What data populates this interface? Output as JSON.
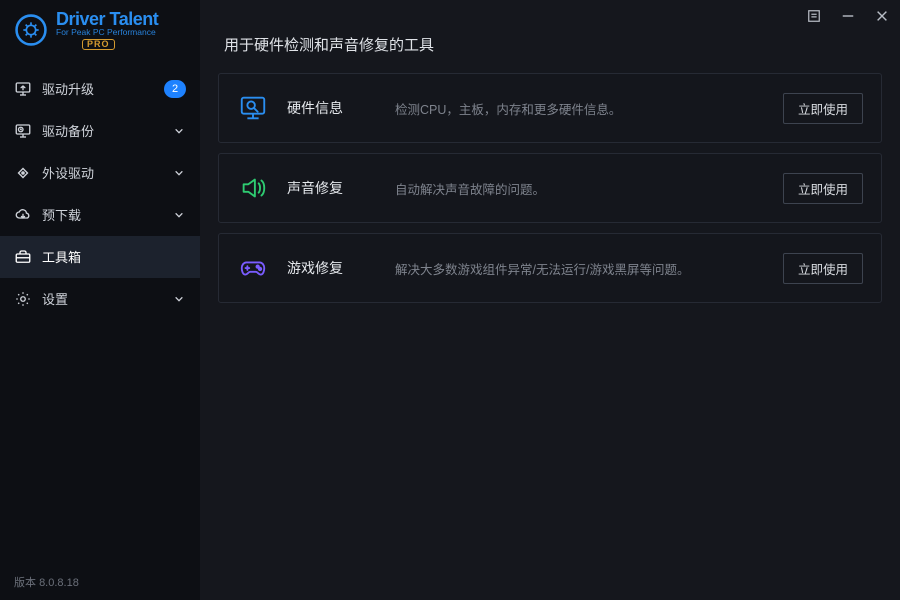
{
  "app": {
    "name": "Driver Talent",
    "tagline": "For Peak PC Performance",
    "edition": "PRO"
  },
  "window_controls": {
    "menu": "menu-icon",
    "minimize": "minimize-icon",
    "close": "close-icon"
  },
  "sidebar": {
    "items": [
      {
        "icon": "monitor-up-icon",
        "label": "驱动升级",
        "badge": "2",
        "has_caret": false
      },
      {
        "icon": "backup-icon",
        "label": "驱动备份",
        "badge": null,
        "has_caret": true
      },
      {
        "icon": "peripheral-icon",
        "label": "外设驱动",
        "badge": null,
        "has_caret": true
      },
      {
        "icon": "cloud-download-icon",
        "label": "预下载",
        "badge": null,
        "has_caret": true
      },
      {
        "icon": "toolbox-icon",
        "label": "工具箱",
        "badge": null,
        "has_caret": false,
        "active": true
      },
      {
        "icon": "gear-icon",
        "label": "设置",
        "badge": null,
        "has_caret": true
      }
    ],
    "version_prefix": "版本",
    "version": "8.0.8.18"
  },
  "page": {
    "title": "用于硬件检测和声音修复的工具",
    "tools": [
      {
        "icon": "hardware-info-icon",
        "icon_color": "#2a8ef0",
        "name": "硬件信息",
        "desc": "检测CPU，主板，内存和更多硬件信息。",
        "action": "立即使用"
      },
      {
        "icon": "sound-repair-icon",
        "icon_color": "#2ecc71",
        "name": "声音修复",
        "desc": "自动解决声音故障的问题。",
        "action": "立即使用"
      },
      {
        "icon": "game-repair-icon",
        "icon_color": "#7a5cff",
        "name": "游戏修复",
        "desc": "解决大多数游戏组件异常/无法运行/游戏黑屏等问题。",
        "action": "立即使用"
      }
    ]
  }
}
